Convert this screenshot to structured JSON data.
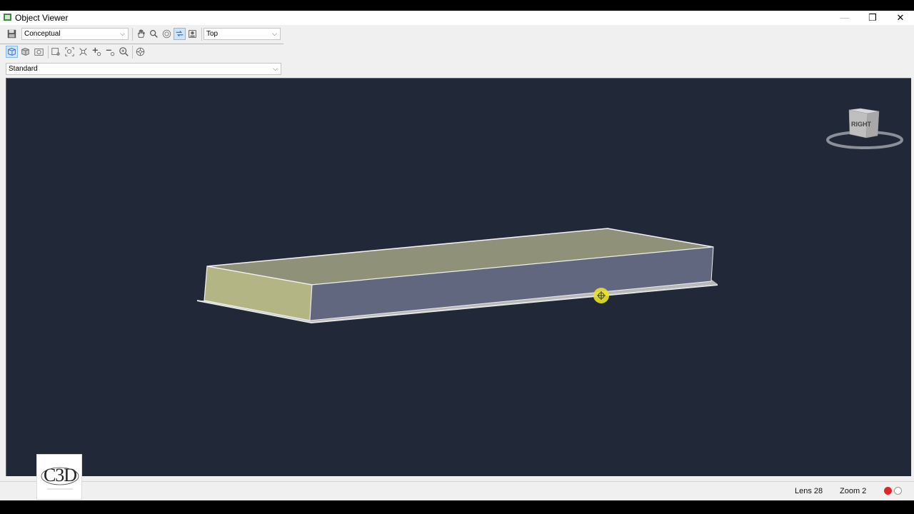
{
  "window": {
    "title": "Object Viewer",
    "controls": {
      "minimize": "—",
      "maximize": "❐",
      "close": "✕"
    }
  },
  "toolbar": {
    "visual_style": "Conceptual",
    "view": "Top",
    "view_style": "Standard"
  },
  "viewcube": {
    "face_label": "RIGHT"
  },
  "statusbar": {
    "lens": "Lens 28",
    "zoom": "Zoom 2"
  },
  "watermark": {
    "logo_text": "C3D"
  },
  "colors": {
    "viewport_bg": "#212837",
    "box_top": "#8f9179",
    "box_end": "#b4b585",
    "box_front": "#61677f",
    "cursor": "#e9e327"
  }
}
